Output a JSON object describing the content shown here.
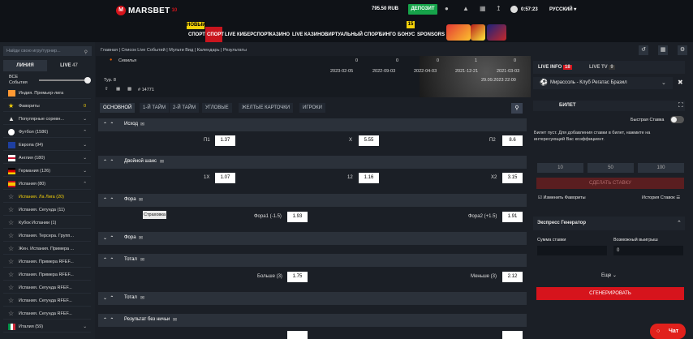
{
  "header": {
    "logo": "MARSBET",
    "logo_sub": "10 years",
    "balance": "795.50 RUB",
    "deposit": "ДЕПОЗИТ",
    "time": "0:57:23",
    "lang": "РУССКИЙ"
  },
  "nav": {
    "badge_new": "НОВЫЙ",
    "badge_15": "15",
    "items": [
      "СПОРТ",
      "СПОРТ",
      "LIVE",
      "КИБЕРСПОРТ",
      "КАЗИНО",
      "LIVE КАЗИНО",
      "ВИРТУАЛЬНЫЙ СПОРТ",
      "БИНГО",
      "БОНУС",
      "SPONSORS"
    ]
  },
  "sidebar": {
    "search_placeholder": "Найди свою игру/турнир...",
    "tab_line": "ЛИНИЯ",
    "tab_live": "LIVE",
    "tab_live_count": "47",
    "slider_label1": "ВСЕ",
    "slider_label2": "События",
    "items": [
      {
        "label": "Индия. Премьер-лига",
        "count": ""
      },
      {
        "label": "Фавориты",
        "count": "0"
      },
      {
        "label": "Популярные соревн...",
        "count": ""
      },
      {
        "label": "Футбол (1586)",
        "count": ""
      },
      {
        "label": "Европа (94)",
        "count": ""
      },
      {
        "label": "Англия (180)",
        "count": ""
      },
      {
        "label": "Германия (126)",
        "count": ""
      },
      {
        "label": "Испания (80)",
        "count": ""
      },
      {
        "label": "Испания. Ла Лига (20)",
        "count": ""
      },
      {
        "label": "Испания. Сегунда (11)",
        "count": ""
      },
      {
        "label": "Кубок Испании (1)",
        "count": ""
      },
      {
        "label": "Испания. Терсера. Групп...",
        "count": ""
      },
      {
        "label": "Жен. Испания. Примера ...",
        "count": ""
      },
      {
        "label": "Испания. Примера RFEF...",
        "count": ""
      },
      {
        "label": "Испания. Примера RFEF...",
        "count": ""
      },
      {
        "label": "Испания. Сегунда RFEF...",
        "count": ""
      },
      {
        "label": "Испания. Сегунда RFEF...",
        "count": ""
      },
      {
        "label": "Испания. Сегунда RFEF...",
        "count": ""
      },
      {
        "label": "Италия (59)",
        "count": ""
      }
    ]
  },
  "breadcrumb": [
    "Главная",
    "Список Live Событий",
    "Мульти Вид",
    "Календарь",
    "Результаты"
  ],
  "event": {
    "team": "Севилья",
    "round": "Тур. 8",
    "match_id": "# 14771",
    "dates": [
      "2023-02-05",
      "2022-09-03",
      "2022-04-03",
      "2021-12-21",
      "2021-03-03"
    ],
    "scores": [
      "0",
      "0",
      "0",
      "1",
      "0"
    ],
    "datetime": "29.09.2023 22:00"
  },
  "tabs": [
    "ОСНОВНОЙ",
    "1-Й ТАЙМ",
    "2-Й ТАЙМ",
    "УГЛОВЫЕ",
    "ЖЕЛТЫЕ КАРТОЧКИ",
    "ИГРОКИ"
  ],
  "markets": [
    {
      "name": "Исход",
      "odds": [
        {
          "label": "П1",
          "value": "1.37"
        },
        {
          "label": "Х",
          "value": "5.55"
        },
        {
          "label": "П2",
          "value": "8.6"
        }
      ]
    },
    {
      "name": "Двойной шанс",
      "odds": [
        {
          "label": "1Х",
          "value": "1.07"
        },
        {
          "label": "12",
          "value": "1.16"
        },
        {
          "label": "Х2",
          "value": "3.15"
        }
      ]
    },
    {
      "name": "Фора",
      "odds": [
        {
          "label": "Фора1 (-1.5)",
          "value": "1.93"
        },
        {
          "label": "Фора2 (+1.5)",
          "value": "1.91"
        }
      ]
    },
    {
      "name": "Фора",
      "odds": []
    },
    {
      "name": "Тотал",
      "odds": [
        {
          "label": "Больше (3)",
          "value": "1.75"
        },
        {
          "label": "Меньше (3)",
          "value": "2.12"
        }
      ]
    },
    {
      "name": "Тотал",
      "odds": []
    },
    {
      "name": "Результат без ничьи",
      "odds": []
    }
  ],
  "tooltip": "Страховка",
  "right": {
    "live_info": "LIVE INFO",
    "live_info_count": "18",
    "live_tv": "LIVE TV",
    "live_tv_count": "9",
    "match": "Мирассоль - Клуб Регатас Бразил",
    "betslip": "БИЛЕТ",
    "quick_bet": "Быстрая Ставка",
    "empty_msg": "Билет пуст. Для добавления ставки в билет, нажмите на интересующий Вас коэффициент.",
    "stakes": [
      "10",
      "50",
      "100"
    ],
    "place_bet": "СДЕЛАТЬ СТАВКУ",
    "change_fav": "Изменить Фавориты",
    "history": "История Ставок",
    "express": "Экспресс Генератор",
    "stake_sum": "Сумма ставки",
    "possible_win": "Возможный выигрыш",
    "stake_value": "0",
    "more": "Еще",
    "generate": "СГЕНЕРИРОВАТЬ",
    "chat": "Чат"
  },
  "colors": {
    "accent": "#d6141c",
    "deposit": "#16a34a",
    "badge": "#f5d20b"
  }
}
